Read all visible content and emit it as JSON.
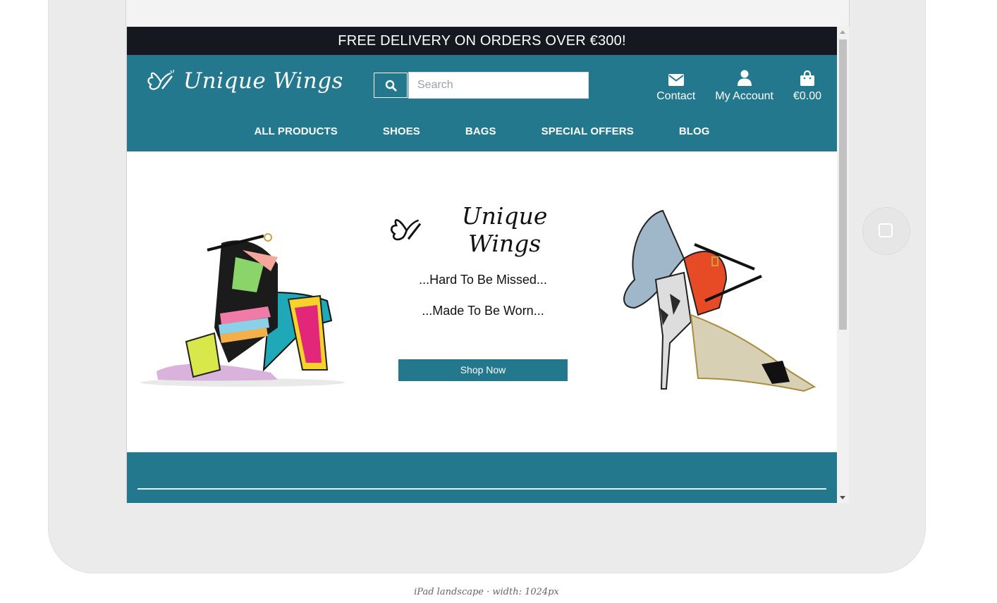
{
  "promo": {
    "text": "FREE DELIVERY ON ORDERS OVER €300!"
  },
  "brand": {
    "name": "Unique Wings"
  },
  "search": {
    "placeholder": "Search"
  },
  "actions": [
    {
      "label": "Contact",
      "icon": "envelope-icon"
    },
    {
      "label": "My Account",
      "icon": "user-icon"
    },
    {
      "label": "€0.00",
      "icon": "shopping-bag-icon"
    }
  ],
  "nav": [
    "ALL PRODUCTS",
    "SHOES",
    "BAGS",
    "SPECIAL OFFERS",
    "BLOG"
  ],
  "hero": {
    "logo_text": "Unique Wings",
    "tagline_1": "...Hard To Be Missed...",
    "tagline_2": "...Made To Be Worn...",
    "cta": "Shop Now"
  },
  "caption": "iPad landscape · width: 1024px",
  "colors": {
    "brand": "#24788d",
    "promo_bg": "#16181f",
    "frame": "#ebebeb"
  }
}
